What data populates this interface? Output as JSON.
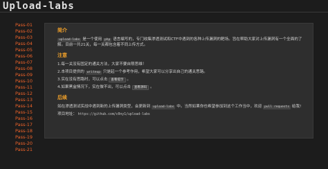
{
  "app": {
    "logo": "Upload-labs"
  },
  "sidebar": {
    "items": [
      {
        "label": "Pass-01"
      },
      {
        "label": "Pass-02"
      },
      {
        "label": "Pass-03"
      },
      {
        "label": "Pass-04"
      },
      {
        "label": "Pass-05"
      },
      {
        "label": "Pass-06"
      },
      {
        "label": "Pass-07"
      },
      {
        "label": "Pass-08"
      },
      {
        "label": "Pass-09"
      },
      {
        "label": "Pass-10"
      },
      {
        "label": "Pass-11"
      },
      {
        "label": "Pass-12"
      },
      {
        "label": "Pass-13"
      },
      {
        "label": "Pass-14"
      },
      {
        "label": "Pass-15"
      },
      {
        "label": "Pass-16"
      },
      {
        "label": "Pass-17"
      },
      {
        "label": "Pass-18"
      },
      {
        "label": "Pass-19"
      },
      {
        "label": "Pass-20"
      },
      {
        "label": "Pass-21"
      }
    ]
  },
  "intro": {
    "title": "简介",
    "code1": "upload-labs",
    "text1": "是一个使用",
    "code2": "php",
    "text2": "语言编写的，专门收集渗透测试和CTF中遇到的各种上传漏洞的靶场。旨在帮助大家对上传漏洞有一个全面的了解。目前一共21关，每一关都包含着不同上传方式。"
  },
  "notice": {
    "title": "注意",
    "item1": "1.每一关没有固定的通关方法，大家不要自限思维！",
    "item2_a": "2.本项目提供的",
    "item2_code": "writeup",
    "item2_b": "只是起一个参考作用，希望大家可以分享出自己的通关思路。",
    "item3_a": "3.实在没有思路时，可以点击",
    "item3_btn": "查看提示",
    "item3_b": "。",
    "item4_a": "4.如果黑盒情况下，实在做不出，可以点击",
    "item4_btn": "查看源码",
    "item4_b": "。"
  },
  "outro": {
    "title": "后续",
    "text_a": "如在渗透测试实战中遇到新的上传漏洞类型，会更新到",
    "code1": "upload-labs",
    "text_b": "中。当然如果你也希望参加到这个工作当中，欢迎",
    "code2": "pull requests",
    "text_c": "给我!",
    "project_label": "项目地址：",
    "project_url": "https://github.com/c0ny1/upload-labs"
  }
}
